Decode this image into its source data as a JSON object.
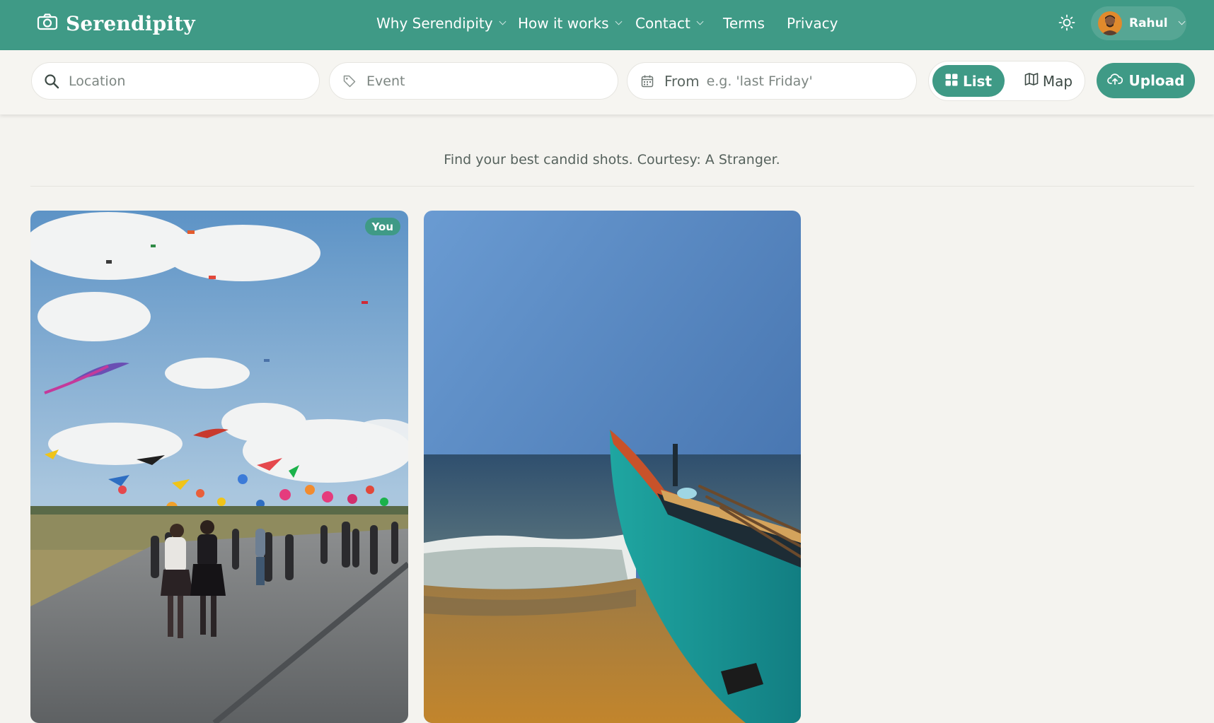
{
  "brand": {
    "name": "Serendipity",
    "logo_icon": "camera-icon"
  },
  "nav": {
    "items": [
      {
        "label": "Why Serendipity",
        "has_dropdown": true
      },
      {
        "label": "How it works",
        "has_dropdown": true
      },
      {
        "label": "Contact",
        "has_dropdown": true
      },
      {
        "label": "Terms",
        "has_dropdown": false
      },
      {
        "label": "Privacy",
        "has_dropdown": false
      }
    ]
  },
  "user": {
    "name": "Rahul",
    "theme_icon": "sun-icon"
  },
  "filters": {
    "location_placeholder": "Location",
    "event_placeholder": "Event",
    "date_prefix": "From",
    "date_placeholder": "e.g. 'last Friday'"
  },
  "view_toggle": {
    "list_label": "List",
    "map_label": "Map",
    "active": "List"
  },
  "upload": {
    "label": "Upload"
  },
  "tagline": "Find your best candid shots. Courtesy: A Stranger.",
  "photos": [
    {
      "badge": "You",
      "subject": "kite festival"
    },
    {
      "badge": "",
      "subject": "boat on beach"
    }
  ],
  "colors": {
    "accent": "#3f9a86",
    "background": "#f4f3ef",
    "text": "#3d4a45"
  }
}
